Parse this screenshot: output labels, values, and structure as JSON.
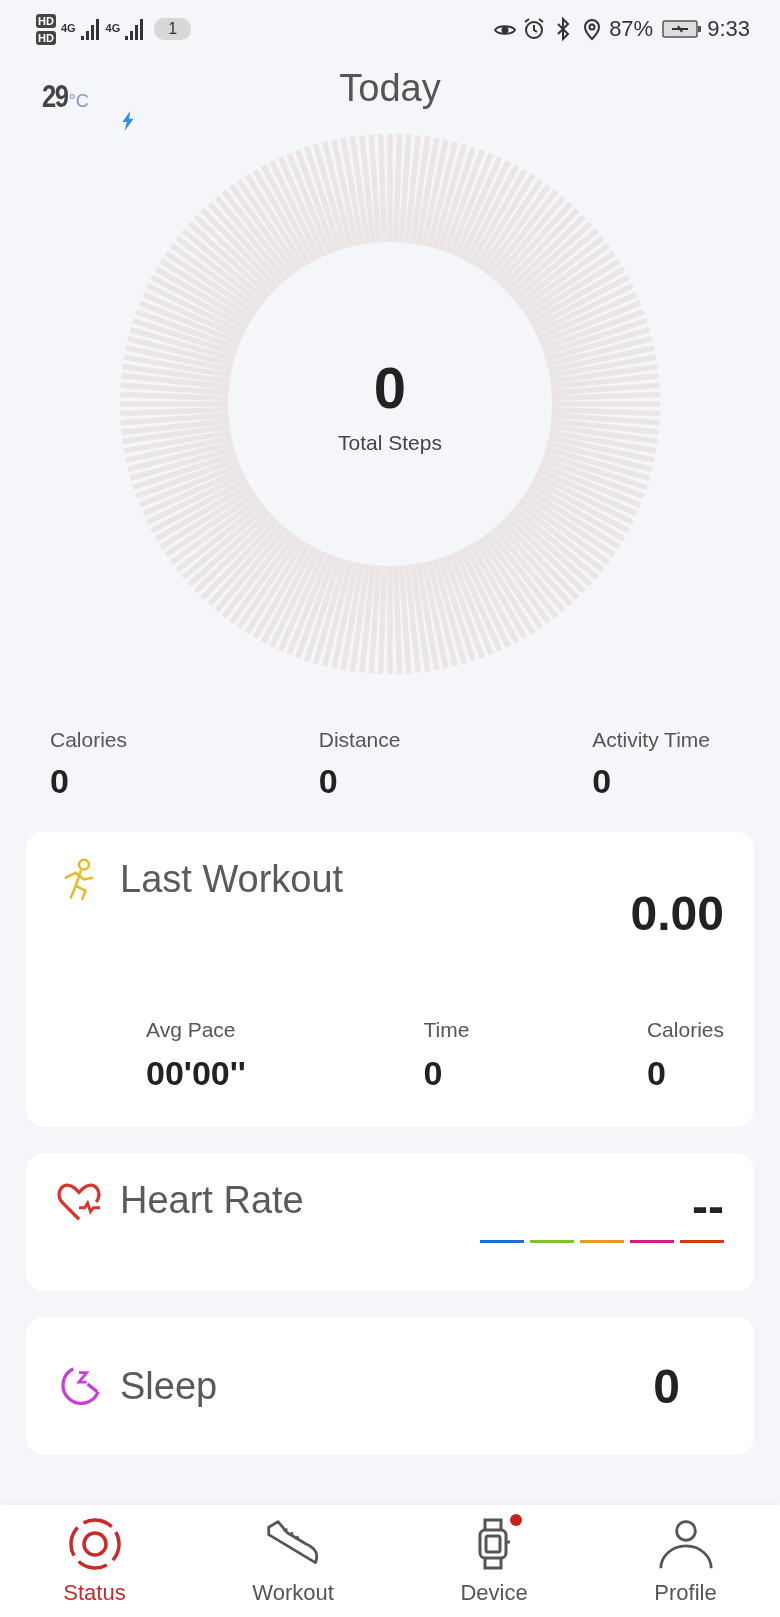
{
  "status_bar": {
    "sim_labels": [
      "HD",
      "HD"
    ],
    "network": [
      "4G",
      "4G"
    ],
    "notification_count": "1",
    "battery": "87%",
    "time": "9:33"
  },
  "weather": {
    "temperature": "29",
    "unit": "°C"
  },
  "header": {
    "title": "Today"
  },
  "steps": {
    "value": "0",
    "label": "Total Steps"
  },
  "stats": [
    {
      "label": "Calories",
      "value": "0"
    },
    {
      "label": "Distance",
      "value": "0"
    },
    {
      "label": "Activity Time",
      "value": "0"
    }
  ],
  "last_workout": {
    "title": "Last Workout",
    "value": "0.00",
    "metrics": [
      {
        "label": "Avg Pace",
        "value": "00'00''"
      },
      {
        "label": "Time",
        "value": "0"
      },
      {
        "label": "Calories",
        "value": "0"
      }
    ]
  },
  "heart_rate": {
    "title": "Heart Rate",
    "value": "--",
    "zones": [
      {
        "color": "#1e6fd0"
      },
      {
        "color": "#7ac52a"
      },
      {
        "color": "#e39a1f"
      },
      {
        "color": "#d6198a"
      },
      {
        "color": "#d63a12"
      }
    ]
  },
  "sleep": {
    "title": "Sleep",
    "value": "0"
  },
  "tabs": [
    {
      "label": "Status",
      "kind": "status",
      "selected": true,
      "badge": false
    },
    {
      "label": "Workout",
      "kind": "workout",
      "selected": false,
      "badge": false
    },
    {
      "label": "Device",
      "kind": "device",
      "selected": false,
      "badge": true
    },
    {
      "label": "Profile",
      "kind": "profile",
      "selected": false,
      "badge": false
    }
  ]
}
